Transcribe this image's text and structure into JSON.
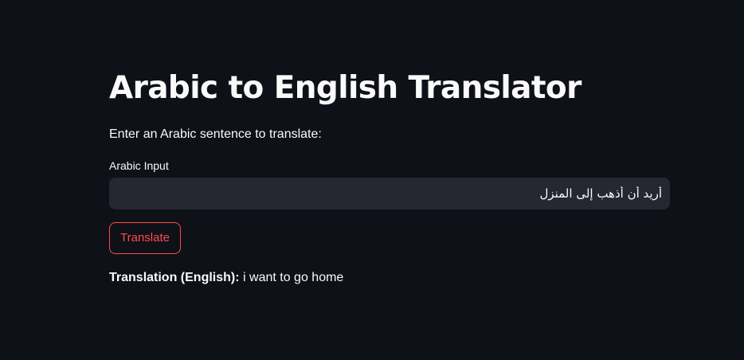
{
  "app": {
    "title": "Arabic to English Translator",
    "prompt": "Enter an Arabic sentence to translate:"
  },
  "input": {
    "label": "Arabic Input",
    "value": "أريد أن أذهب إلى المنزل"
  },
  "button": {
    "label": "Translate"
  },
  "result": {
    "label": "Translation (English):",
    "value": "i want to go home"
  },
  "colors": {
    "background": "#0e1117",
    "input_background": "#262730",
    "accent": "#ff4b4b",
    "text": "#fafafa"
  }
}
